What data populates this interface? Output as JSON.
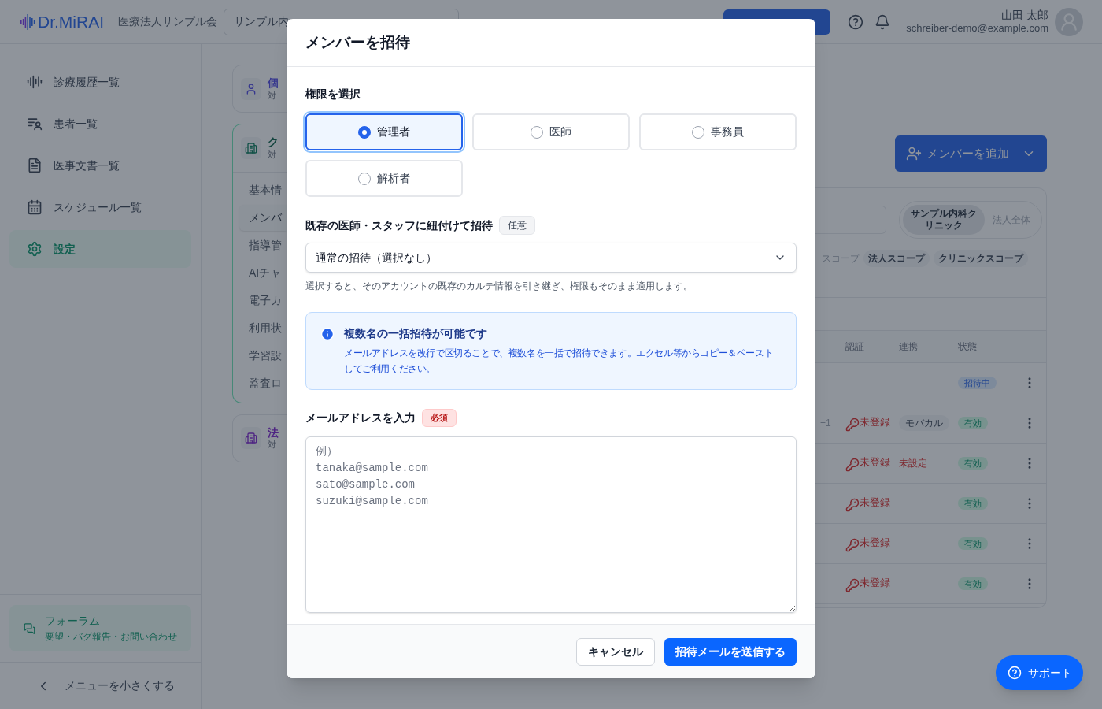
{
  "header": {
    "logo": "Dr.MiRAI",
    "organization": "医療法人サンプル会",
    "clinic_select": "サンプル内",
    "user": {
      "name": "山田 太郎",
      "email": "schreiber-demo@example.com"
    }
  },
  "sidebar": {
    "items": [
      {
        "label": "診療履歴一覧",
        "selected": false
      },
      {
        "label": "患者一覧",
        "selected": false
      },
      {
        "label": "医事文書一覧",
        "selected": false
      },
      {
        "label": "スケジュール一覧",
        "selected": false
      },
      {
        "label": "設定",
        "selected": true
      }
    ],
    "forum": {
      "title": "フォーラム",
      "subtitle": "要望・バグ報告・お問い合わせ"
    },
    "collapse": "メニューを小さくする"
  },
  "scope_cards": [
    {
      "kind": "personal",
      "title": "個",
      "subtitle": "対",
      "selected": false
    },
    {
      "kind": "clinic",
      "title": "ク",
      "subtitle": "対",
      "selected": true,
      "menu": [
        {
          "label": "基本情",
          "selected": false
        },
        {
          "label": "メンバ",
          "selected": true
        },
        {
          "label": "指導管",
          "selected": false
        },
        {
          "label": "AIチャ",
          "selected": false
        },
        {
          "label": "電子カ",
          "selected": false
        },
        {
          "label": "利用状",
          "selected": false
        },
        {
          "label": "学習設",
          "selected": false
        },
        {
          "label": "監査ロ",
          "selected": false
        }
      ]
    },
    {
      "kind": "corporate",
      "title": "法",
      "subtitle": "対",
      "selected": false
    }
  ],
  "members": {
    "add_button": "メンバーを追加",
    "org_toggle": [
      {
        "label": "サンプル内科クリニック",
        "selected": true
      },
      {
        "label": "法人全体",
        "selected": false
      }
    ],
    "scope_label": "スコープ",
    "scope_chips": [
      "法人スコープ",
      "クリニックスコープ"
    ],
    "columns": [
      "認証",
      "連携",
      "状態"
    ],
    "rows": [
      {
        "status": {
          "text": "招待中",
          "kind": "invited"
        }
      },
      {
        "column_1": "+1",
        "auth": "未登録",
        "link": {
          "text": "モバカル",
          "kind": "chip"
        },
        "status": {
          "text": "有効",
          "kind": "active"
        }
      },
      {
        "auth": "未登録",
        "link": {
          "text": "未設定",
          "kind": "unset"
        },
        "status": {
          "text": "有効",
          "kind": "active"
        }
      },
      {
        "auth": "未登録",
        "status": {
          "text": "有効",
          "kind": "active"
        }
      },
      {
        "auth": "未登録",
        "status": {
          "text": "有効",
          "kind": "active"
        }
      },
      {
        "auth": "未登録",
        "status": {
          "text": "有効",
          "kind": "active"
        }
      }
    ]
  },
  "dialog": {
    "title": "メンバーを招待",
    "role_label": "権限を選択",
    "roles": [
      {
        "label": "管理者",
        "selected": true
      },
      {
        "label": "医師",
        "selected": false
      },
      {
        "label": "事務員",
        "selected": false
      },
      {
        "label": "解析者",
        "selected": false
      }
    ],
    "link_label": "既存の医師・スタッフに紐付けて招待",
    "link_badge": "任意",
    "link_select": "通常の招待（選択なし）",
    "link_help": "選択すると、そのアカウントの既存のカルテ情報を引き継ぎ、権限もそのまま適用します。",
    "info": {
      "title": "複数名の一括招待が可能です",
      "body": "メールアドレスを改行で区切ることで、複数名を一括で招待できます。エクセル等からコピー＆ペーストしてご利用ください。"
    },
    "email_label": "メールアドレスを入力",
    "email_badge": "必須",
    "email_placeholder": "例）\ntanaka@sample.com\nsato@sample.com\nsuzuki@sample.com",
    "buttons": [
      {
        "label": "キャンセル",
        "kind": "secondary"
      },
      {
        "label": "招待メールを送信する",
        "kind": "primary"
      }
    ]
  },
  "support_button": "サポート"
}
